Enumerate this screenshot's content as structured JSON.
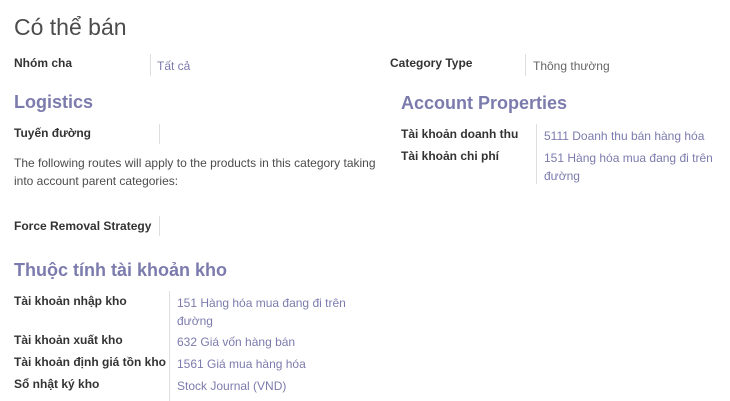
{
  "page": {
    "title": "Có thể bán"
  },
  "top": {
    "parent_label": "Nhóm cha",
    "parent_value": "Tất cả",
    "type_label": "Category Type",
    "type_value": "Thông thường"
  },
  "logistics": {
    "heading": "Logistics",
    "routes_label": "Tuyến đường",
    "routes_value": "",
    "routes_note": "The following routes will apply to the products in this category taking into account parent categories:",
    "removal_label": "Force Removal Strategy",
    "removal_value": ""
  },
  "account_properties": {
    "heading": "Account Properties",
    "income_label": "Tài khoản doanh thu",
    "income_value": "5111 Doanh thu bán hàng hóa",
    "expense_label": "Tài khoản chi phí",
    "expense_value": "151 Hàng hóa mua đang đi trên đường"
  },
  "stock_accounts": {
    "heading": "Thuộc tính tài khoản kho",
    "input_label": "Tài khoản nhập kho",
    "input_value": "151 Hàng hóa mua đang đi trên đường",
    "output_label": "Tài khoản xuất kho",
    "output_value": "632 Giá vốn hàng bán",
    "valuation_label": "Tài khoản định giá tồn kho",
    "valuation_value": "1561 Giá mua hàng hóa",
    "journal_label": "Sổ nhật ký kho",
    "journal_value": "Stock Journal (VND)"
  }
}
